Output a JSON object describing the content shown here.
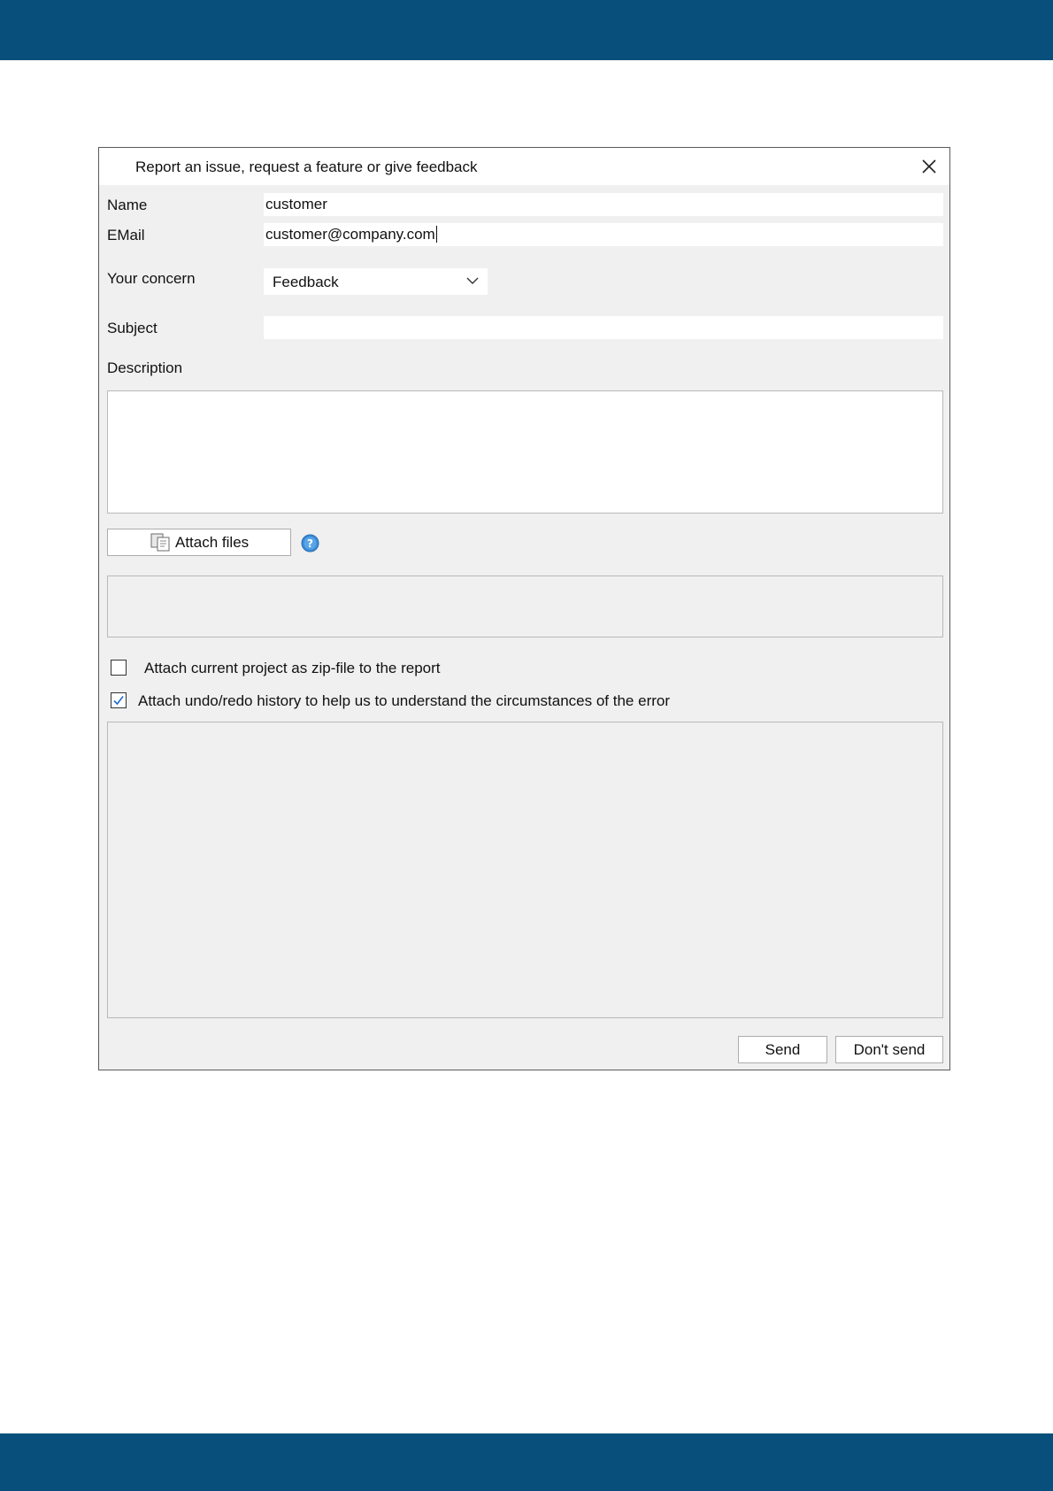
{
  "dialog": {
    "title": "Report an issue, request a feature or give feedback"
  },
  "form": {
    "name_label": "Name",
    "name_value": "customer",
    "email_label": "EMail",
    "email_value": "customer@company.com",
    "concern_label": "Your concern",
    "concern_value": "Feedback",
    "subject_label": "Subject",
    "subject_value": "",
    "description_label": "Description",
    "description_value": ""
  },
  "attachments": {
    "attach_button_label": "Attach files"
  },
  "options": {
    "attach_project_label": "Attach current project as zip-file to the report",
    "attach_project_checked": false,
    "attach_history_label": "Attach undo/redo history to help us to understand the circumstances of the error",
    "attach_history_checked": true
  },
  "buttons": {
    "send_label": "Send",
    "dont_send_label": "Don't send"
  },
  "colors": {
    "header_band": "#08507b",
    "dialog_bg": "#f0f0f0",
    "help_icon": "#3d8bd6"
  },
  "icons": [
    "close-icon",
    "chevron-down-icon",
    "attach-files-icon",
    "help-icon",
    "checkmark-icon"
  ]
}
